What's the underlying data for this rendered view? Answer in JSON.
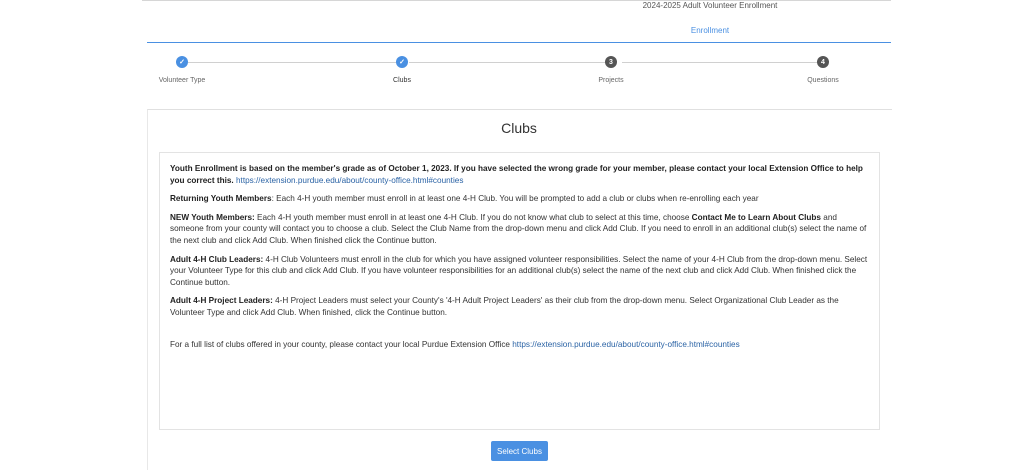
{
  "header": {
    "program_title": "2024-2025 Adult Volunteer Enrollment",
    "active_tab": "Enrollment"
  },
  "stepper": {
    "steps": [
      {
        "label": "Volunteer Type",
        "marker": "✓",
        "status": "complete"
      },
      {
        "label": "Clubs",
        "marker": "✓",
        "status": "active"
      },
      {
        "label": "Projects",
        "marker": "3",
        "status": "pending"
      },
      {
        "label": "Questions",
        "marker": "4",
        "status": "pending"
      }
    ]
  },
  "main": {
    "title": "Clubs",
    "info": {
      "lead_text": "Youth Enrollment is based on the member's grade as of October 1, 2023. If you have selected the wrong grade for your member, please contact your local Extension Office to help you correct this.",
      "lead_link": "https://extension.purdue.edu/about/county-office.html#counties",
      "returning_heading": "Returning Youth Members",
      "returning_text": ": Each 4-H youth member must enroll in at least one 4-H Club. You will be prompted to add a club or clubs when re-enrolling each year",
      "new_heading": "NEW Youth Members:",
      "new_text_1": " Each 4-H youth member must enroll in at least one 4-H Club. If you do not know what club to select at this time, choose ",
      "new_emphasis": "Contact Me to Learn About Clubs",
      "new_text_2": " and someone from your county will contact you to choose a club. Select the Club Name from the drop-down menu and click Add Club. If you need to enroll in an additional club(s) select the name of the next club and click Add Club. When finished click the Continue button.",
      "leaders_heading": "Adult 4-H Club Leaders:",
      "leaders_text": " 4-H Club Volunteers must enroll in the club for which you have assigned volunteer responsibilities. Select the name of your 4-H Club from the drop-down menu. Select your Volunteer Type for this club and click Add Club. If you have volunteer responsibilities for an additional club(s) select the name of the next club and click Add Club. When finished click the Continue button.",
      "project_heading": "Adult 4-H Project Leaders:",
      "project_text": " 4-H Project Leaders must select your County's '4-H Adult Project Leaders' as their club from the drop-down menu. Select Organizational Club Leader as the Volunteer Type and click Add Club. When finished, click the Continue button.",
      "footer_text": "For a full list of clubs offered in your county, please contact your local Purdue Extension Office ",
      "footer_link": "https://extension.purdue.edu/about/county-office.html#counties"
    },
    "select_button": "Select Clubs"
  },
  "colors": {
    "accent": "#4a90e2",
    "pending_step": "#555555",
    "link": "#2b63a5"
  }
}
